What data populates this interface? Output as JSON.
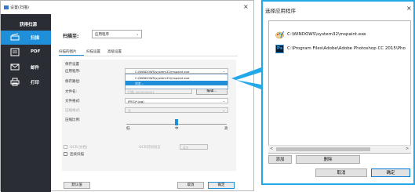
{
  "main_window": {
    "title": "设置(扫描)",
    "close": "×",
    "sidebar": {
      "header": "获得扫源",
      "items": [
        {
          "label": "扫描",
          "icon": "scanner-icon",
          "active": true
        },
        {
          "label": "PDF",
          "icon": "pdf-icon",
          "active": false
        },
        {
          "label": "邮件",
          "icon": "mail-icon",
          "active": false
        },
        {
          "label": "打印",
          "icon": "printer-icon",
          "active": false
        }
      ]
    },
    "scan_label": "扫描至:",
    "scan_select": "应用程序",
    "tabs": [
      "扫描的图片",
      "扫描设置",
      "高级设置"
    ],
    "panel": {
      "section_title": "保存设置",
      "app_label": "应用程序:",
      "app_value": "C:\\WINDOWS\\system32\\mspaint.exe",
      "dropdown_options": [
        "C:\\WINDOWS\\system32\\mspaint.exe",
        "浏览..."
      ],
      "save_location_label": "保存路径:",
      "file_name_label": "文件名:",
      "file_name_value": "扫描_0000000001",
      "edit_button": "编辑...",
      "file_format_label": "文件格式:",
      "file_format_value": "JPEG(*.jpg)",
      "compression_label": "压缩格式:",
      "compression_value": "无",
      "quality_label": "压缩比例:",
      "quality_low": "低",
      "quality_mid": "中",
      "quality_high": "高",
      "quality_level": 0.5,
      "ocr_label": "OCR(文档)",
      "ocr_lang_label": "OCR识别语言",
      "ocr_lang_value": "英文",
      "continuous_scan_label": "连续扫描"
    },
    "footer": {
      "default_button": "默认值",
      "cancel_button": "取消",
      "ok_button": "确定"
    }
  },
  "dialog": {
    "title": "选择应用程序",
    "close": "×",
    "apps": [
      {
        "path": "C:\\WINDOWS\\system32\\mspaint.exe",
        "icon": "paint-icon"
      },
      {
        "path": "C:\\Program Files\\Adobe\\Adobe Photoshop CC 2015\\Pho",
        "icon": "photoshop-icon"
      }
    ],
    "ps_icon_text": "Ps",
    "scroll_left": "<",
    "scroll_right": ">",
    "add_button": "添加",
    "delete_button": "删除",
    "cancel_button": "取消",
    "confirm_button": "确定"
  },
  "colors": {
    "accent": "#1f8fd9",
    "sidebar_bg": "#2a2d33",
    "dialog_border": "#23a8e8"
  }
}
